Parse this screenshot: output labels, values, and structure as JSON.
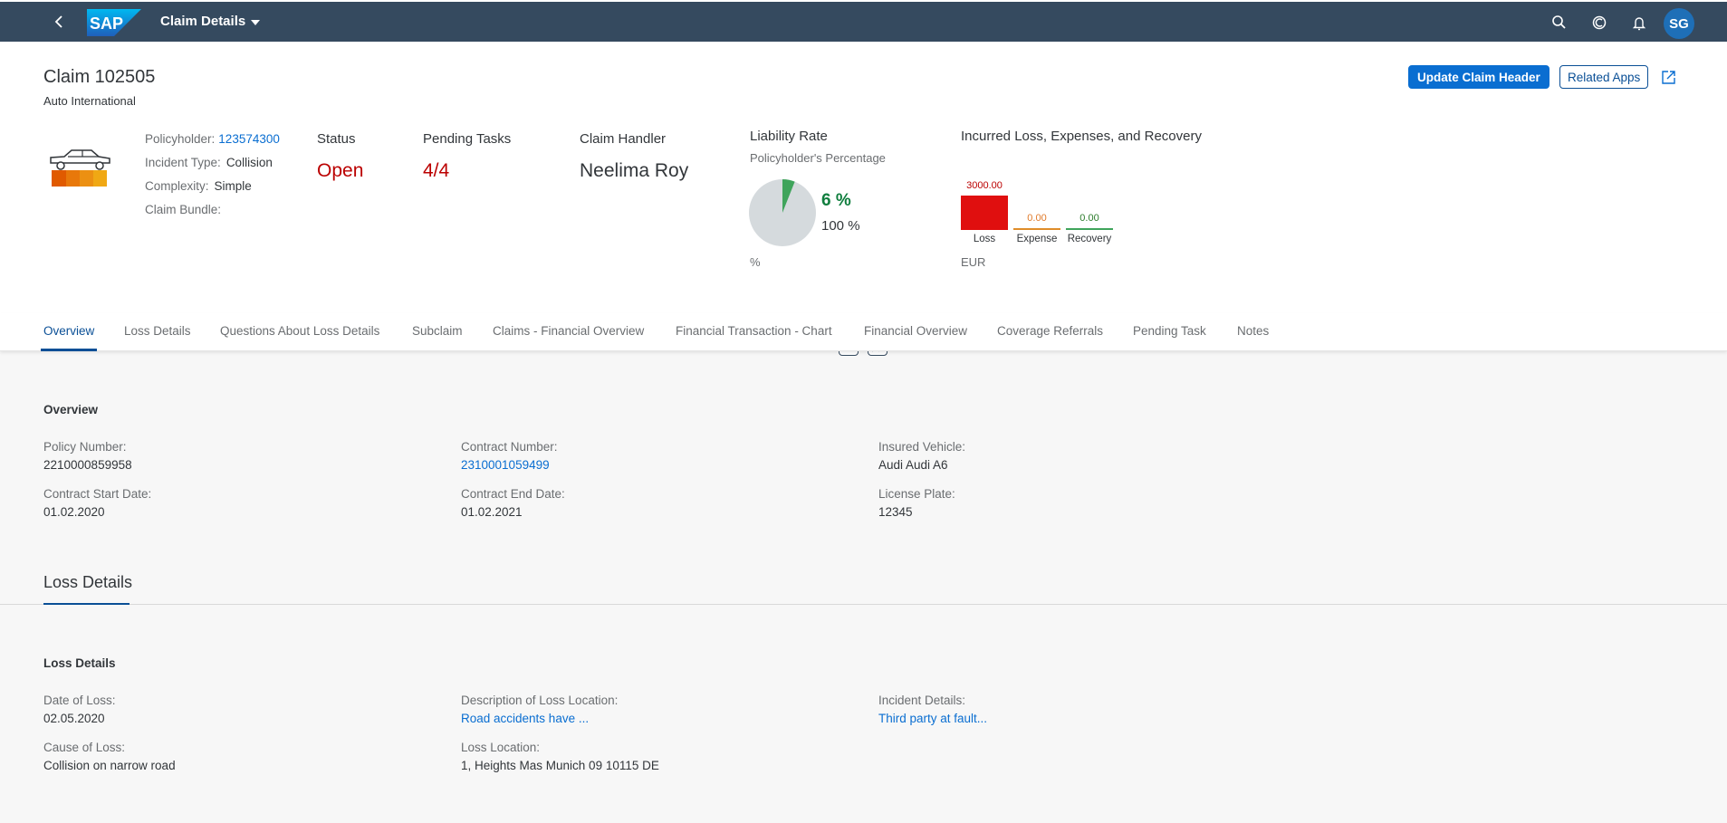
{
  "shell": {
    "app_title": "Claim Details",
    "logo_text": "SAP",
    "avatar_initials": "SG",
    "icons": [
      "back-icon",
      "search-icon",
      "copilot-icon",
      "notification-bell-icon"
    ]
  },
  "header": {
    "claim_title": "Claim 102505",
    "claim_subtitle": "Auto International",
    "actions": {
      "update": "Update Claim Header",
      "related": "Related Apps"
    },
    "attributes": {
      "policyholder_label": "Policyholder:",
      "policyholder_value": "123574300",
      "incident_label": "Incident Type:",
      "incident_value": "Collision",
      "complexity_label": "Complexity:",
      "complexity_value": "Simple",
      "bundle_label": "Claim Bundle:",
      "bundle_value": ""
    },
    "kpis": {
      "status_label": "Status",
      "status_value": "Open",
      "pending_label": "Pending Tasks",
      "pending_value": "4/4",
      "handler_label": "Claim Handler",
      "handler_value": "Neelima Roy"
    },
    "liability": {
      "title": "Liability Rate",
      "subtitle": "Policyholder's Percentage",
      "value_label": "6 %",
      "total_label": "100 %",
      "unit": "%",
      "value_percent": 6,
      "color_value": "#3fa45b",
      "color_rest": "#d5dadd"
    },
    "incurred": {
      "title": "Incurred Loss, Expenses, and Recovery",
      "unit": "EUR",
      "bars": [
        {
          "label": "Loss",
          "value_label": "3000.00",
          "value": 3000,
          "color": "#e00f0f",
          "label_color": "#bb0000"
        },
        {
          "label": "Expense",
          "value_label": "0.00",
          "value": 0,
          "color": "#df8d2a",
          "label_color": "#e07a2a"
        },
        {
          "label": "Recovery",
          "value_label": "0.00",
          "value": 0,
          "color": "#3fa45b",
          "label_color": "#2b7c2b"
        }
      ]
    }
  },
  "tabs": [
    {
      "label": "Overview",
      "active": true
    },
    {
      "label": "Loss Details",
      "active": false
    },
    {
      "label": "Questions About Loss Details",
      "active": false
    },
    {
      "label": "Subclaim",
      "active": false
    },
    {
      "label": "Claims - Financial Overview",
      "active": false
    },
    {
      "label": "Financial Transaction - Chart",
      "active": false
    },
    {
      "label": "Financial Overview",
      "active": false
    },
    {
      "label": "Coverage Referrals",
      "active": false
    },
    {
      "label": "Pending Task",
      "active": false
    },
    {
      "label": "Notes",
      "active": false
    }
  ],
  "overview": {
    "title": "Overview",
    "fields": [
      {
        "label": "Policy Number:",
        "value": "2210000859958",
        "link": false
      },
      {
        "label": "Contract Number:",
        "value": "2310001059499",
        "link": true
      },
      {
        "label": "Insured Vehicle:",
        "value": "Audi Audi A6",
        "link": false
      },
      {
        "label": "Contract Start Date:",
        "value": "01.02.2020",
        "link": false
      },
      {
        "label": "Contract End Date:",
        "value": "01.02.2021",
        "link": false
      },
      {
        "label": "License Plate:",
        "value": "12345",
        "link": false
      }
    ]
  },
  "loss_details": {
    "anchor_title": "Loss Details",
    "title": "Loss Details",
    "fields": [
      {
        "label": "Date of Loss:",
        "value": "02.05.2020",
        "link": false
      },
      {
        "label": "Description of Loss Location:",
        "value": "Road accidents have ...",
        "link": true
      },
      {
        "label": "Incident Details:",
        "value": "Third party at fault...",
        "link": true
      },
      {
        "label": "Cause of Loss:",
        "value": "Collision on narrow road",
        "link": false
      },
      {
        "label": "Loss Location:",
        "value": "1, Heights Mas Munich 09 10115 DE",
        "link": false
      }
    ]
  }
}
